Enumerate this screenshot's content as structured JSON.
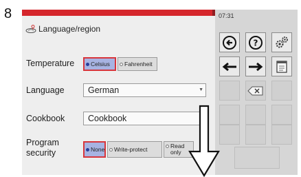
{
  "step_number": "8",
  "header": {
    "title": "Language/region",
    "icon": "globe-location-icon"
  },
  "clock": "07:31",
  "temperature": {
    "label": "Temperature",
    "options": [
      {
        "label": "Celsius",
        "selected": true
      },
      {
        "label": "Fahrenheit",
        "selected": false
      }
    ]
  },
  "language": {
    "label": "Language",
    "value": "German"
  },
  "cookbook": {
    "label": "Cookbook",
    "value": "Cookbook"
  },
  "program_security": {
    "label_line1": "Program",
    "label_line2": "security",
    "options": [
      {
        "label": "None",
        "selected": true
      },
      {
        "label": "Write-protect",
        "selected": false
      },
      {
        "label_line1": "Read",
        "label_line2": "only",
        "selected": false
      }
    ]
  },
  "right_panel": {
    "buttons": [
      {
        "name": "back",
        "icon": "circle-left-arrow-icon"
      },
      {
        "name": "help",
        "icon": "question-mark-icon"
      },
      {
        "name": "settings",
        "icon": "gears-icon"
      },
      {
        "name": "previous",
        "icon": "left-arrow-icon"
      },
      {
        "name": "next",
        "icon": "right-arrow-icon"
      },
      {
        "name": "document",
        "icon": "document-icon"
      },
      {
        "name": "backspace",
        "icon": "backspace-icon"
      }
    ]
  },
  "colors": {
    "accent_red": "#d5262c",
    "selected_fill": "#a7b3e2",
    "screen_bg": "#eeeeee",
    "panel_bg": "#d6d6d6"
  }
}
